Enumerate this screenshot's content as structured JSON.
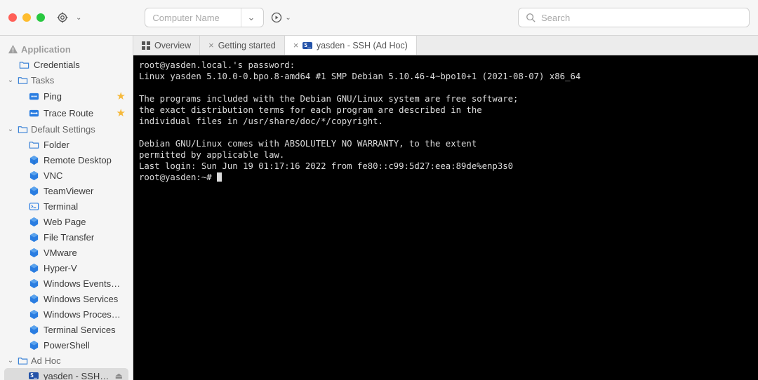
{
  "toolbar": {
    "computer_placeholder": "Computer Name",
    "search_placeholder": "Search"
  },
  "sidebar": {
    "application_label": "Application",
    "credentials_label": "Credentials",
    "tasks_label": "Tasks",
    "tasks": {
      "ping": "Ping",
      "traceroute": "Trace Route"
    },
    "default_settings_label": "Default Settings",
    "defaults": {
      "folder": "Folder",
      "remote_desktop": "Remote Desktop",
      "vnc": "VNC",
      "teamviewer": "TeamViewer",
      "terminal": "Terminal",
      "webpage": "Web Page",
      "file_transfer": "File Transfer",
      "vmware": "VMware",
      "hyperv": "Hyper-V",
      "windows_events": "Windows Events…",
      "windows_services": "Windows Services",
      "windows_processes": "Windows Proces…",
      "terminal_services": "Terminal Services",
      "powershell": "PowerShell"
    },
    "adhoc_label": "Ad Hoc",
    "adhoc": {
      "yasden": "yasden - SSH…"
    }
  },
  "tabs": {
    "overview": "Overview",
    "getting_started": "Getting started",
    "yasden": "yasden - SSH (Ad Hoc)"
  },
  "terminal": {
    "l1": "root@yasden.local.'s password:",
    "l2": "Linux yasden 5.10.0-0.bpo.8-amd64 #1 SMP Debian 5.10.46-4~bpo10+1 (2021-08-07) x86_64",
    "l3": "",
    "l4": "The programs included with the Debian GNU/Linux system are free software;",
    "l5": "the exact distribution terms for each program are described in the",
    "l6": "individual files in /usr/share/doc/*/copyright.",
    "l7": "",
    "l8": "Debian GNU/Linux comes with ABSOLUTELY NO WARRANTY, to the extent",
    "l9": "permitted by applicable law.",
    "l10": "Last login: Sun Jun 19 01:17:16 2022 from fe80::c99:5d27:eea:89de%enp3s0",
    "l11": "root@yasden:~# "
  }
}
